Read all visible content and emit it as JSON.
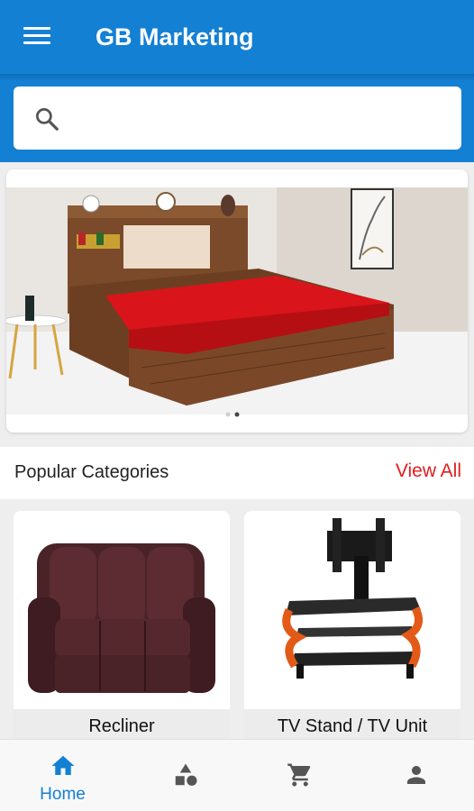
{
  "app": {
    "title": "GB Marketing",
    "accent": "#1380d4"
  },
  "search": {
    "placeholder": "",
    "value": ""
  },
  "banner": {
    "dots": 2,
    "active_dot": 1
  },
  "categories": {
    "heading": "Popular Categories",
    "view_all": "View All",
    "items": [
      {
        "label": "Recliner",
        "icon": "recliner-image"
      },
      {
        "label": "TV Stand / TV Unit",
        "icon": "tv-stand-image"
      }
    ]
  },
  "bottom_nav": {
    "items": [
      {
        "label": "Home",
        "icon": "home-icon",
        "active": true
      },
      {
        "label": "",
        "icon": "categories-icon",
        "active": false
      },
      {
        "label": "",
        "icon": "cart-icon",
        "active": false
      },
      {
        "label": "",
        "icon": "profile-icon",
        "active": false
      }
    ]
  }
}
